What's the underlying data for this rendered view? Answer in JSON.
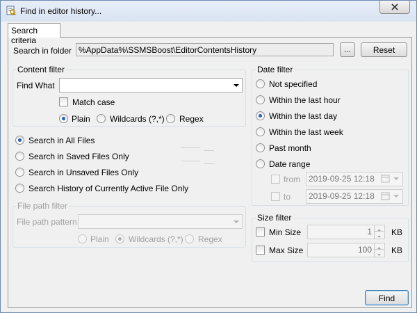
{
  "window": {
    "title": "Find in editor history..."
  },
  "tabs": [
    {
      "label": "Search criteria"
    }
  ],
  "folder": {
    "label": "Search in folder",
    "value": "%AppData%\\SSMSBoost\\EditorContentsHistory",
    "browse_label": "...",
    "reset_label": "Reset"
  },
  "content_filter": {
    "title": "Content filter",
    "find_what_label": "Find What",
    "find_what_value": "",
    "match_case_label": "Match case",
    "match_case_checked": false,
    "modes": [
      {
        "label": "Plain",
        "selected": true
      },
      {
        "label": "Wildcards (?,*)",
        "selected": false
      },
      {
        "label": "Regex",
        "selected": false
      }
    ]
  },
  "scope": {
    "options": [
      {
        "label": "Search in All Files",
        "selected": true
      },
      {
        "label": "Search in Saved Files Only",
        "selected": false
      },
      {
        "label": "Search in Unsaved Files Only",
        "selected": false
      },
      {
        "label": "Search History of Currently Active File Only",
        "selected": false
      }
    ]
  },
  "file_path_filter": {
    "title": "File path filter",
    "pattern_label": "File path pattern",
    "pattern_value": "",
    "modes": [
      {
        "label": "Plain",
        "selected": false
      },
      {
        "label": "Wildcards (?,*)",
        "selected": true
      },
      {
        "label": "Regex",
        "selected": false
      }
    ]
  },
  "date_filter": {
    "title": "Date filter",
    "options": [
      {
        "label": "Not specified",
        "selected": false
      },
      {
        "label": "Within the last hour",
        "selected": false
      },
      {
        "label": "Within the last day",
        "selected": true
      },
      {
        "label": "Within the last week",
        "selected": false
      },
      {
        "label": "Past month",
        "selected": false
      },
      {
        "label": "Date range",
        "selected": false
      }
    ],
    "from_label": "from",
    "from_value": "2019-09-25 12:18",
    "to_label": "to",
    "to_value": "2019-09-25 12:18"
  },
  "size_filter": {
    "title": "Size filter",
    "min_label": "Min Size",
    "min_value": "1",
    "max_label": "Max Size",
    "max_value": "100",
    "unit": "KB"
  },
  "actions": {
    "find_label": "Find"
  },
  "colors": {
    "accent": "#2a62b8",
    "frame": "#6d8ab3",
    "group_border": "#d5dfe5"
  }
}
